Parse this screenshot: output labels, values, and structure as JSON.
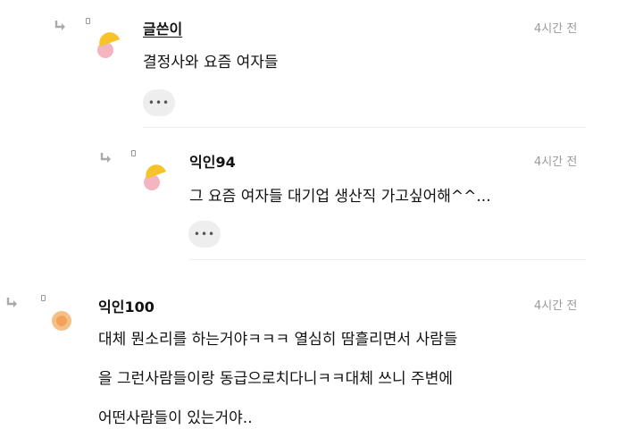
{
  "comments": [
    {
      "author": "글쓴이",
      "time": "4시간 전",
      "text": "결정사와 요즘 여자들",
      "more_icon": "ellipsis-icon",
      "more_label": "•••"
    },
    {
      "author": "익인94",
      "time": "4시간 전",
      "text": "그 요즘 여자들 대기업 생산직 가고싶어해^^...",
      "more_icon": "ellipsis-icon",
      "more_label": "•••"
    },
    {
      "author": "익인100",
      "time": "4시간 전",
      "lines": [
        "대체 뭔소리를 하는거야ㅋㅋㅋ 열심히 땀흘리면서 사람들",
        "을 그런사람들이랑 동급으로치다니ㅋㅋ대체 쓰니 주변에",
        "어떤사람들이 있는거야.."
      ]
    }
  ],
  "icons": {
    "reply": "reply-arrow-icon",
    "avatar_writer": "writer-avatar-icon",
    "avatar_user": "user-avatar-icon"
  },
  "colors": {
    "avatar_yellow": "#f6c32a",
    "avatar_pink": "#f5b5c0",
    "avatar_orange": "#f4a259",
    "time_gray": "#9a9a9a"
  }
}
